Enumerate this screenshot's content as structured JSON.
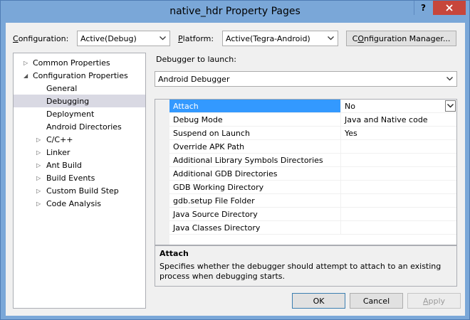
{
  "window": {
    "title": "native_hdr Property Pages",
    "help_label": "?",
    "close_label": "X"
  },
  "config": {
    "configuration_label_prefix": "",
    "configuration_label_hotkey": "C",
    "configuration_label_rest": "onfiguration:",
    "configuration_value": "Active(Debug)",
    "platform_label_hotkey": "P",
    "platform_label_rest": "latform:",
    "platform_value": "Active(Tegra-Android)",
    "manager_hotkey": "O",
    "manager_rest": "nfiguration Manager...",
    "manager_prefix": "C"
  },
  "tree": {
    "items": [
      {
        "label": "Common Properties",
        "expander": "▷"
      },
      {
        "label": "Configuration Properties",
        "expander": "◢"
      },
      {
        "label": "General",
        "expander": ""
      },
      {
        "label": "Debugging",
        "expander": ""
      },
      {
        "label": "Deployment",
        "expander": ""
      },
      {
        "label": "Android Directories",
        "expander": ""
      },
      {
        "label": "C/C++",
        "expander": "▷"
      },
      {
        "label": "Linker",
        "expander": "▷"
      },
      {
        "label": "Ant Build",
        "expander": "▷"
      },
      {
        "label": "Build Events",
        "expander": "▷"
      },
      {
        "label": "Custom Build Step",
        "expander": "▷"
      },
      {
        "label": "Code Analysis",
        "expander": "▷"
      }
    ]
  },
  "debugger": {
    "label": "Debugger to launch:",
    "value": "Android Debugger"
  },
  "properties": [
    {
      "name": "Attach",
      "value": "No"
    },
    {
      "name": "Debug Mode",
      "value": "Java and Native code"
    },
    {
      "name": "Suspend on Launch",
      "value": "Yes"
    },
    {
      "name": "Override APK Path",
      "value": ""
    },
    {
      "name": "Additional Library Symbols Directories",
      "value": ""
    },
    {
      "name": "Additional GDB Directories",
      "value": ""
    },
    {
      "name": "GDB Working Directory",
      "value": ""
    },
    {
      "name": "gdb.setup File Folder",
      "value": ""
    },
    {
      "name": "Java Source Directory",
      "value": ""
    },
    {
      "name": "Java Classes Directory",
      "value": ""
    }
  ],
  "description": {
    "title": "Attach",
    "text": "Specifies whether the debugger should attempt to attach to an existing process when debugging starts."
  },
  "buttons": {
    "ok": "OK",
    "cancel": "Cancel",
    "apply": "Apply"
  },
  "colors": {
    "title_bar": "#7aa7d8",
    "close_button": "#c7463b",
    "selection": "#3399ff",
    "tree_selection": "#d9d9e3"
  }
}
